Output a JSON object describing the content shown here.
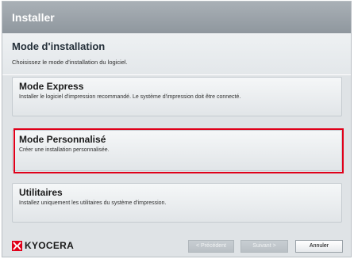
{
  "window": {
    "title": "Installer"
  },
  "header": {
    "title": "Mode d'installation",
    "subtitle": "Choisissez le mode d'installation du logiciel."
  },
  "options": [
    {
      "title": "Mode Express",
      "description": "Installer le logiciel d'impression recommandé. Le système d'impression doit être connecté."
    },
    {
      "title": "Mode Personnalisé",
      "description": "Créer une installation personnalisée."
    },
    {
      "title": "Utilitaires",
      "description": "Installez uniquement les utilitaires du système d'impression."
    }
  ],
  "footer": {
    "brand": "KYOCERA",
    "brand_color": "#e0001a",
    "prev_label": "< Précédent",
    "next_label": "Suivant >",
    "cancel_label": "Annuler"
  }
}
